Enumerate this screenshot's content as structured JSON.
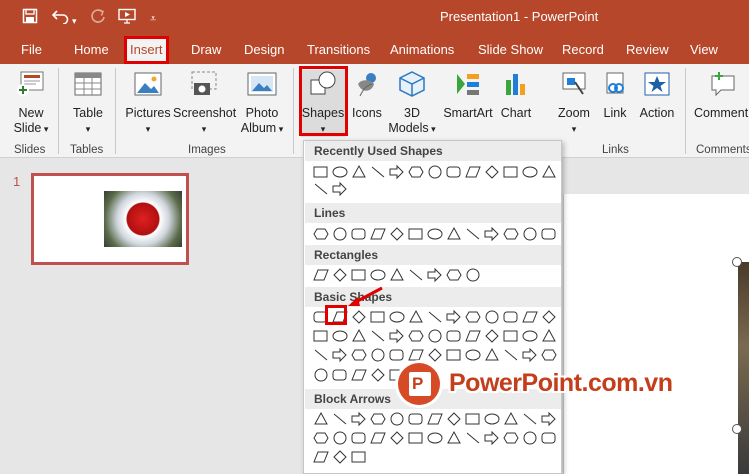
{
  "window": {
    "title": "Presentation1  -  PowerPoint"
  },
  "tabs": [
    "File",
    "Home",
    "Insert",
    "Draw",
    "Design",
    "Transitions",
    "Animations",
    "Slide Show",
    "Record",
    "Review",
    "View"
  ],
  "ribbon": {
    "new_slide": "New\nSlide",
    "table": "Table",
    "pictures": "Pictures",
    "screenshot": "Screenshot",
    "photo_album": "Photo\nAlbum",
    "shapes": "Shapes",
    "icons": "Icons",
    "models_3d": "3D\nModels",
    "smartart": "SmartArt",
    "chart": "Chart",
    "zoom": "Zoom",
    "link": "Link",
    "action": "Action",
    "comment": "Comment",
    "groups": {
      "slides": "Slides",
      "tables": "Tables",
      "images": "Images",
      "links": "Links",
      "comments": "Comments"
    }
  },
  "thumbnail": {
    "number": "1"
  },
  "shapes_menu": {
    "sections": [
      "Recently Used Shapes",
      "Lines",
      "Rectangles",
      "Basic Shapes",
      "Block Arrows"
    ]
  },
  "watermark": {
    "text": "PowerPoint.com.vn"
  },
  "colors": {
    "brand": "#b7472a",
    "highlight": "#e00000"
  }
}
